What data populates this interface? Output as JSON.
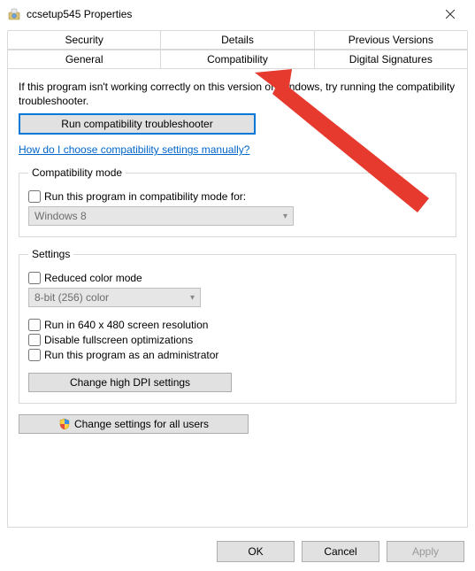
{
  "window": {
    "title": "ccsetup545 Properties"
  },
  "tabs": {
    "row1": [
      "Security",
      "Details",
      "Previous Versions"
    ],
    "row2": [
      "General",
      "Compatibility",
      "Digital Signatures"
    ],
    "active": "Compatibility"
  },
  "content": {
    "intro": "If this program isn't working correctly on this version of Windows, try running the compatibility troubleshooter.",
    "troubleshoot_button": "Run compatibility troubleshooter",
    "help_link": "How do I choose compatibility settings manually?",
    "compat_mode": {
      "legend": "Compatibility mode",
      "checkbox": "Run this program in compatibility mode for:",
      "dropdown_value": "Windows 8"
    },
    "settings": {
      "legend": "Settings",
      "reduced_color": "Reduced color mode",
      "color_dropdown_value": "8-bit (256) color",
      "low_res": "Run in 640 x 480 screen resolution",
      "disable_fullscreen": "Disable fullscreen optimizations",
      "run_admin": "Run this program as an administrator",
      "change_dpi": "Change high DPI settings"
    },
    "all_users_button": "Change settings for all users"
  },
  "buttons": {
    "ok": "OK",
    "cancel": "Cancel",
    "apply": "Apply"
  },
  "icons": {
    "app": "installer-icon",
    "shield": "uac-shield-icon",
    "close": "close-icon",
    "chevron": "chevron-down-icon"
  }
}
